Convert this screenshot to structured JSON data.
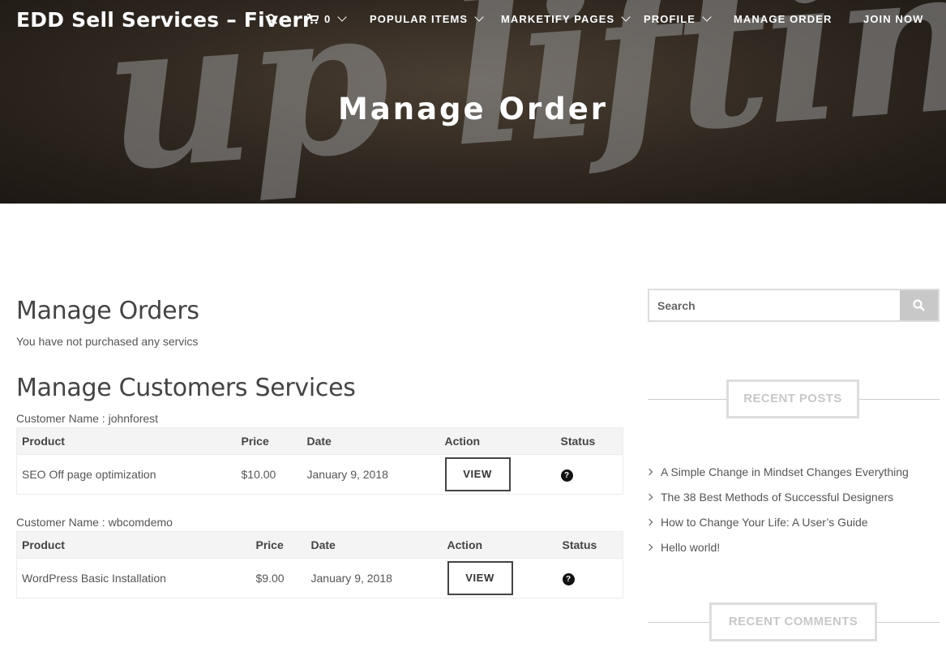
{
  "site": {
    "brand": "EDD Sell Services – Fiverr"
  },
  "nav": {
    "cart_count": "0",
    "items": [
      {
        "label": "POPULAR ITEMS",
        "dropdown": true
      },
      {
        "label": "MARKETIFY PAGES",
        "dropdown": true
      },
      {
        "label": "PROFILE",
        "dropdown": true
      },
      {
        "label": "MANAGE ORDER",
        "dropdown": false
      },
      {
        "label": "JOIN NOW",
        "dropdown": false
      }
    ]
  },
  "hero": {
    "title": "Manage Order"
  },
  "main": {
    "orders_heading": "Manage Orders",
    "orders_note": "You have not purchased any servics",
    "customers_heading": "Manage Customers Services",
    "columns": {
      "product": "Product",
      "price": "Price",
      "date": "Date",
      "action": "Action",
      "status": "Status"
    },
    "customers": [
      {
        "label": "Customer Name : johnforest",
        "rows": [
          {
            "product": "SEO Off page optimization",
            "price": "$10.00",
            "date": "January 9, 2018",
            "action": "VIEW",
            "status_icon": "?"
          }
        ]
      },
      {
        "label": "Customer Name : wbcomdemo",
        "rows": [
          {
            "product": "WordPress Basic Installation",
            "price": "$9.00",
            "date": "January 9, 2018",
            "action": "VIEW",
            "status_icon": "?"
          }
        ]
      }
    ]
  },
  "sidebar": {
    "search_placeholder": "Search",
    "recent_posts_title": "RECENT POSTS",
    "recent_posts": [
      "A Simple Change in Mindset Changes Everything",
      "The 38 Best Methods of Successful Designers",
      "How to Change Your Life: A User’s Guide",
      "Hello world!"
    ],
    "recent_comments_title": "RECENT COMMENTS"
  }
}
